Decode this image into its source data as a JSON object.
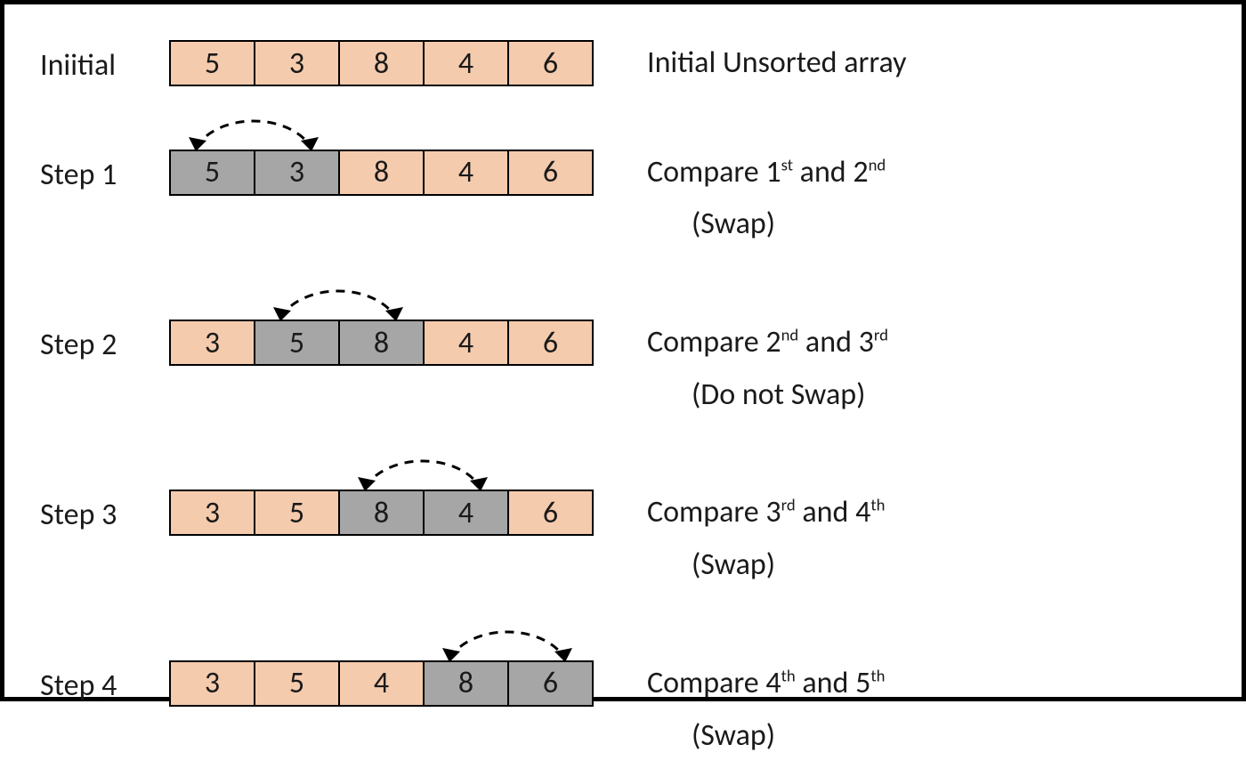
{
  "rows": [
    {
      "id": "initial",
      "label": "Iniitial",
      "cells": [
        {
          "v": "5",
          "hl": false
        },
        {
          "v": "3",
          "hl": false
        },
        {
          "v": "8",
          "hl": false
        },
        {
          "v": "4",
          "hl": false
        },
        {
          "v": "6",
          "hl": false
        }
      ],
      "desc_main_html": "Initial Unsorted array",
      "desc_sub": null,
      "arrow": null
    },
    {
      "id": "step1",
      "label": "Step 1",
      "cells": [
        {
          "v": "5",
          "hl": true
        },
        {
          "v": "3",
          "hl": true
        },
        {
          "v": "8",
          "hl": false
        },
        {
          "v": "4",
          "hl": false
        },
        {
          "v": "6",
          "hl": false
        }
      ],
      "desc_main_html": "Compare 1<sup>st</sup> and 2<sup>nd</sup>",
      "desc_sub": "(Swap)",
      "arrow": 0
    },
    {
      "id": "step2",
      "label": "Step 2",
      "cells": [
        {
          "v": "3",
          "hl": false
        },
        {
          "v": "5",
          "hl": true
        },
        {
          "v": "8",
          "hl": true
        },
        {
          "v": "4",
          "hl": false
        },
        {
          "v": "6",
          "hl": false
        }
      ],
      "desc_main_html": "Compare 2<sup>nd</sup> and 3<sup>rd</sup>",
      "desc_sub": "(Do not Swap)",
      "arrow": 1
    },
    {
      "id": "step3",
      "label": "Step 3",
      "cells": [
        {
          "v": "3",
          "hl": false
        },
        {
          "v": "5",
          "hl": false
        },
        {
          "v": "8",
          "hl": true
        },
        {
          "v": "4",
          "hl": true
        },
        {
          "v": "6",
          "hl": false
        }
      ],
      "desc_main_html": "Compare 3<sup>rd</sup> and 4<sup>th</sup>",
      "desc_sub": "(Swap)",
      "arrow": 2
    },
    {
      "id": "step4",
      "label": "Step 4",
      "cells": [
        {
          "v": "3",
          "hl": false
        },
        {
          "v": "5",
          "hl": false
        },
        {
          "v": "4",
          "hl": false
        },
        {
          "v": "8",
          "hl": true
        },
        {
          "v": "6",
          "hl": true
        }
      ],
      "desc_main_html": "Compare 4<sup>th</sup> and 5<sup>th</sup>",
      "desc_sub": "(Swap)",
      "arrow": 3
    }
  ],
  "colors": {
    "peach": "#f5cbad",
    "grey": "#a6a6a6",
    "border": "#000000"
  }
}
